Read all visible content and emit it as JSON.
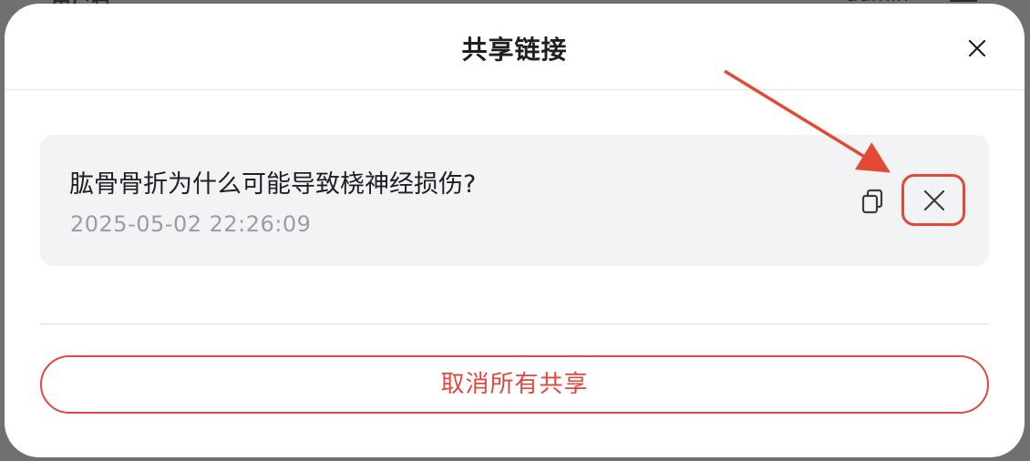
{
  "background": {
    "left_text": "用户名",
    "right_text": "admin"
  },
  "modal": {
    "title": "共享链接",
    "close_icon": "close-icon"
  },
  "share_item": {
    "title": "肱骨骨折为什么可能导致桡神经损伤?",
    "timestamp": "2025-05-02 22:26:09",
    "copy_icon": "copy-icon",
    "delete_icon": "close-icon"
  },
  "footer": {
    "cancel_all_label": "取消所有共享"
  },
  "colors": {
    "accent_red": "#e0483e",
    "card_bg": "#f2f3f5",
    "annotation_red": "#e24a33"
  }
}
